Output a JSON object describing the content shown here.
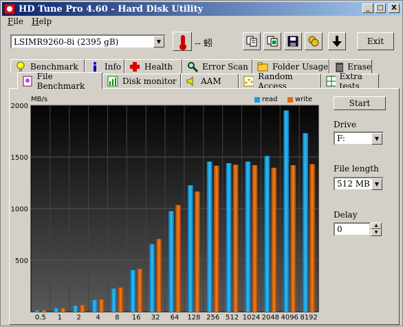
{
  "window": {
    "title": "HD Tune Pro 4.60 - Hard Disk Utility",
    "min": "_",
    "max": "□",
    "close": "X"
  },
  "menu": {
    "file": "File",
    "help": "Help"
  },
  "toolbar": {
    "drive": "LSIMR9260-8i (2395 gB)",
    "temperature": "-- 蚓",
    "exit": "Exit"
  },
  "tabs_top": [
    "Benchmark",
    "Info",
    "Health",
    "Error Scan",
    "Folder Usage",
    "Erase"
  ],
  "tabs_bottom": [
    "File Benchmark",
    "Disk monitor",
    "AAM",
    "Random Access",
    "Extra tests"
  ],
  "side": {
    "start": "Start",
    "drive_label": "Drive",
    "drive_value": "F:",
    "file_length_label": "File length",
    "file_length_value": "512 MB",
    "delay_label": "Delay",
    "delay_value": "0"
  },
  "chart_data": {
    "type": "bar",
    "ylabel": "MB/s",
    "yticks": [
      "2000",
      "1500",
      "1000",
      "500"
    ],
    "ylim": [
      0,
      2000
    ],
    "categories": [
      "0.5",
      "1",
      "2",
      "4",
      "8",
      "16",
      "32",
      "64",
      "128",
      "256",
      "512",
      "1024",
      "2048",
      "4096",
      "8192"
    ],
    "series": [
      {
        "name": "read",
        "color": "#1aa0e0",
        "values": [
          15,
          35,
          60,
          115,
          225,
          405,
          655,
          975,
          1225,
          1455,
          1440,
          1455,
          1510,
          1950,
          1730
        ]
      },
      {
        "name": "write",
        "color": "#e06a10",
        "values": [
          15,
          35,
          65,
          120,
          235,
          415,
          705,
          1035,
          1165,
          1415,
          1425,
          1420,
          1395,
          1420,
          1430
        ]
      }
    ]
  }
}
